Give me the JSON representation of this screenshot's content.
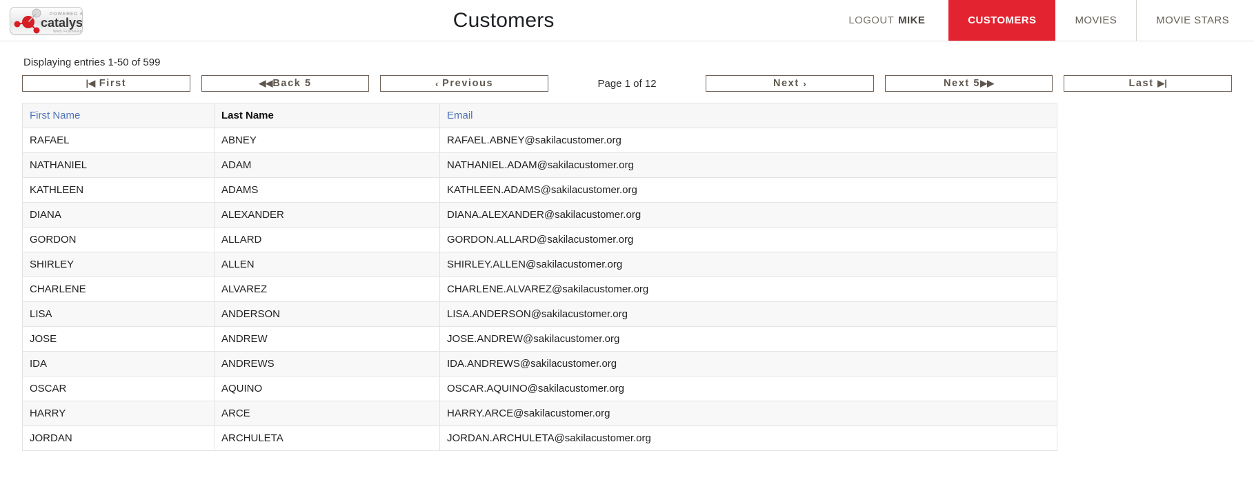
{
  "header": {
    "logo": {
      "powered_by": "POWERED BY",
      "name": "catalyst",
      "tagline": "Web Framework"
    },
    "title": "Customers",
    "nav": [
      {
        "label": "LOGOUT",
        "user": "MIKE",
        "type": "logout",
        "active": false
      },
      {
        "label": "CUSTOMERS",
        "type": "link",
        "active": true
      },
      {
        "label": "MOVIES",
        "type": "link",
        "active": false
      },
      {
        "label": "MOVIE STARS",
        "type": "link",
        "active": false
      }
    ]
  },
  "toolbar": {
    "entries_text": "Displaying entries 1-50 of 599",
    "page_status": "Page 1 of 12",
    "buttons": {
      "first": "First",
      "first_icon": "|◀",
      "back5": "Back 5",
      "back5_icon": "◀◀",
      "previous": "Previous",
      "previous_icon": "‹",
      "next": "Next",
      "next_icon": "›",
      "next5": "Next 5",
      "next5_icon": "▶▶",
      "last": "Last",
      "last_icon": "▶|"
    }
  },
  "table": {
    "columns": [
      {
        "label": "First Name",
        "sorted": false
      },
      {
        "label": "Last Name",
        "sorted": true
      },
      {
        "label": "Email",
        "sorted": false
      }
    ],
    "rows": [
      {
        "first_name": "RAFAEL",
        "last_name": "ABNEY",
        "email": "RAFAEL.ABNEY@sakilacustomer.org"
      },
      {
        "first_name": "NATHANIEL",
        "last_name": "ADAM",
        "email": "NATHANIEL.ADAM@sakilacustomer.org"
      },
      {
        "first_name": "KATHLEEN",
        "last_name": "ADAMS",
        "email": "KATHLEEN.ADAMS@sakilacustomer.org"
      },
      {
        "first_name": "DIANA",
        "last_name": "ALEXANDER",
        "email": "DIANA.ALEXANDER@sakilacustomer.org"
      },
      {
        "first_name": "GORDON",
        "last_name": "ALLARD",
        "email": "GORDON.ALLARD@sakilacustomer.org"
      },
      {
        "first_name": "SHIRLEY",
        "last_name": "ALLEN",
        "email": "SHIRLEY.ALLEN@sakilacustomer.org"
      },
      {
        "first_name": "CHARLENE",
        "last_name": "ALVAREZ",
        "email": "CHARLENE.ALVAREZ@sakilacustomer.org"
      },
      {
        "first_name": "LISA",
        "last_name": "ANDERSON",
        "email": "LISA.ANDERSON@sakilacustomer.org"
      },
      {
        "first_name": "JOSE",
        "last_name": "ANDREW",
        "email": "JOSE.ANDREW@sakilacustomer.org"
      },
      {
        "first_name": "IDA",
        "last_name": "ANDREWS",
        "email": "IDA.ANDREWS@sakilacustomer.org"
      },
      {
        "first_name": "OSCAR",
        "last_name": "AQUINO",
        "email": "OSCAR.AQUINO@sakilacustomer.org"
      },
      {
        "first_name": "HARRY",
        "last_name": "ARCE",
        "email": "HARRY.ARCE@sakilacustomer.org"
      },
      {
        "first_name": "JORDAN",
        "last_name": "ARCHULETA",
        "email": "JORDAN.ARCHULETA@sakilacustomer.org"
      }
    ]
  },
  "colors": {
    "accent_red": "#e32330",
    "link_blue": "#4c72b8",
    "button_border": "#6e6257"
  }
}
